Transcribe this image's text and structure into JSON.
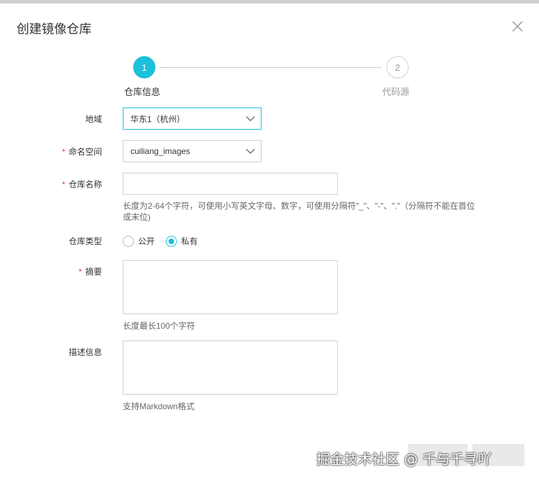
{
  "dialog": {
    "title": "创建镜像仓库"
  },
  "steps": [
    {
      "number": "1",
      "label": "仓库信息"
    },
    {
      "number": "2",
      "label": "代码源"
    }
  ],
  "form": {
    "region": {
      "label": "地域",
      "value": "华东1（杭州）"
    },
    "namespace": {
      "label": "命名空间",
      "required_mark": "*",
      "value": "cuiliang_images"
    },
    "repo_name": {
      "label": "仓库名称",
      "required_mark": "*",
      "value": "",
      "hint_line1": "长度为2-64个字符，可使用小写英文字母、数字，可使用分隔符\"_\"、\"-\"、\".\"（分隔符不能在首位",
      "hint_line2": "或末位)"
    },
    "repo_type": {
      "label": "仓库类型",
      "options": [
        {
          "label": "公开",
          "checked": false
        },
        {
          "label": "私有",
          "checked": true
        }
      ]
    },
    "summary": {
      "label": "摘要",
      "required_mark": "*",
      "value": "",
      "hint": "长度最长100个字符"
    },
    "description": {
      "label": "描述信息",
      "value": "",
      "hint": "支持Markdown格式"
    }
  },
  "watermark": "掘金技术社区 @ 千与千寻吖",
  "colors": {
    "accent": "#1cc0d8",
    "required": "#e23c39"
  }
}
